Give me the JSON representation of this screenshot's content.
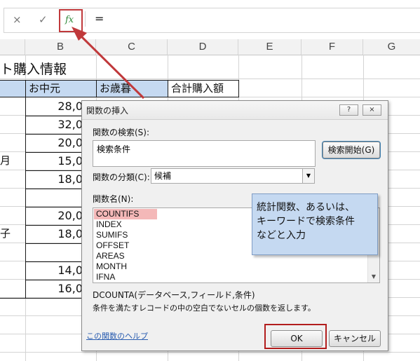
{
  "formula_bar": {
    "cancel_icon": "×",
    "enter_icon": "✓",
    "fx_label": "fx",
    "formula": "="
  },
  "columns": [
    "B",
    "C",
    "D",
    "E",
    "F",
    "G"
  ],
  "sheet": {
    "title": "ト購入情報",
    "headers": [
      "お中元",
      "お歳暮",
      "合計購入額"
    ],
    "left_fragments": [
      "月",
      "子"
    ],
    "b_values": [
      "28,0",
      "32,0",
      "20,0",
      "15,0",
      "18,0",
      "20,0",
      "18,0",
      "14,0",
      "16,0"
    ]
  },
  "dialog": {
    "title": "関数の挿入",
    "help_btn": "?",
    "close_btn": "×",
    "search_label": "関数の検索(S):",
    "search_value": "検索条件",
    "search_button": "検索開始(G)",
    "category_label": "関数の分類(C):",
    "category_value": "候補",
    "func_list_label": "関数名(N):",
    "functions": [
      "COUNTIFS",
      "INDEX",
      "SUMIFS",
      "OFFSET",
      "AREAS",
      "MONTH",
      "IFNA"
    ],
    "selected_function": "COUNTIFS",
    "syntax": "DCOUNTA(データベース,フィールド,条件)",
    "description": "条件を満たすレコードの中の空白でないセルの個数を返します。",
    "help_link": "この関数のヘルプ",
    "ok": "OK",
    "cancel": "キャンセル"
  },
  "note": {
    "line1": "統計関数、あるいは、",
    "line2": "キーワードで検索条件",
    "line3": "などと入力"
  },
  "colors": {
    "highlight_red": "#c0393b",
    "header_fill": "#c5d9f1",
    "selected_item": "#f4b8b8",
    "fx_green": "#2f8a3a"
  }
}
